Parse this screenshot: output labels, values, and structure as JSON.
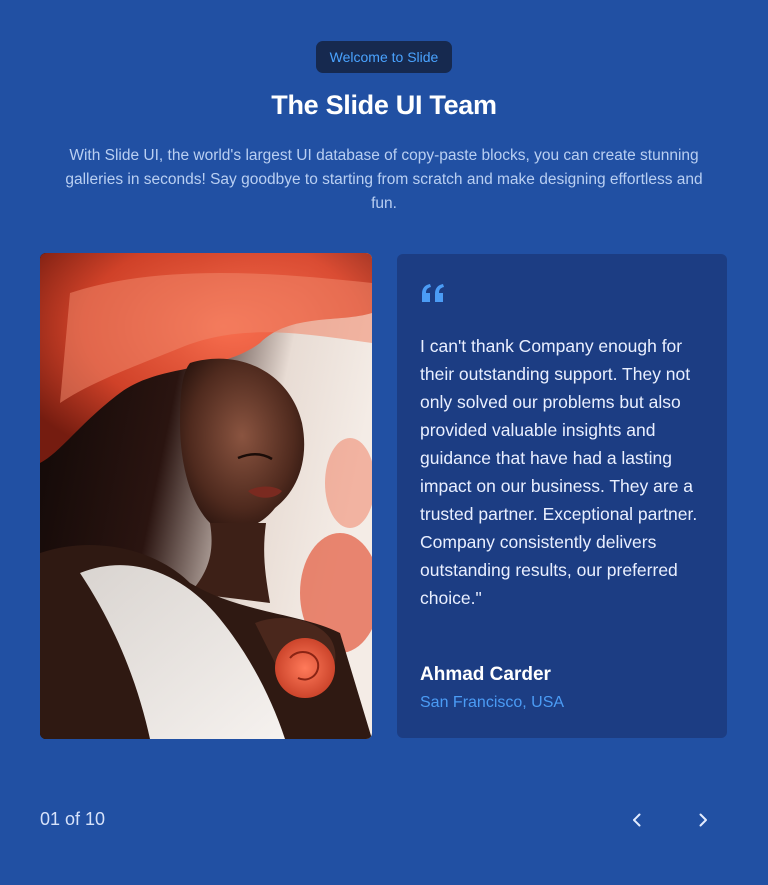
{
  "header": {
    "badge": "Welcome to Slide",
    "title": "The Slide UI Team",
    "subtitle": "With Slide UI, the world's largest UI database of copy-paste blocks, you can create stunning galleries in seconds! Say goodbye to starting from scratch and make designing effortless and fun."
  },
  "testimonial": {
    "quote_icon": "quote-icon",
    "quote": "I can't thank Company enough for their outstanding support. They not only solved our problems but also provided valuable insights and guidance that have had a lasting impact on our business. They are a trusted partner. Exceptional partner. Company consistently delivers outstanding results, our preferred choice.\"",
    "author": "Ahmad Carder",
    "location": "San Francisco, USA"
  },
  "pagination": {
    "counter": "01 of 10",
    "prev_icon": "chevron-left-icon",
    "next_icon": "chevron-right-icon"
  },
  "colors": {
    "background": "#2150a3",
    "card": "#1c3d83",
    "accent": "#4b9cf5",
    "badge_bg": "#16294f"
  }
}
